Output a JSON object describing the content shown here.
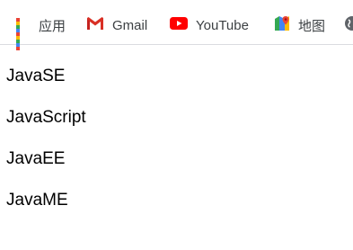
{
  "bookmarks": {
    "apps_label": "应用",
    "gmail_label": "Gmail",
    "youtube_label": "YouTube",
    "maps_label": "地图"
  },
  "icons": {
    "apps": "apps-grid-icon",
    "gmail": "gmail-icon",
    "youtube": "youtube-icon",
    "maps": "maps-icon",
    "more": "globe-icon"
  },
  "colors": {
    "apps_dots": [
      "#ea4335",
      "#fbbc04",
      "#34a853",
      "#4285f4",
      "#ea4335",
      "#fbbc04",
      "#34a853",
      "#4285f4",
      "#ea4335"
    ],
    "youtube_red": "#ff0000",
    "gmail_red": "#d93025"
  },
  "content": {
    "items": [
      "JavaSE",
      "JavaScript",
      "JavaEE",
      "JavaME"
    ]
  }
}
